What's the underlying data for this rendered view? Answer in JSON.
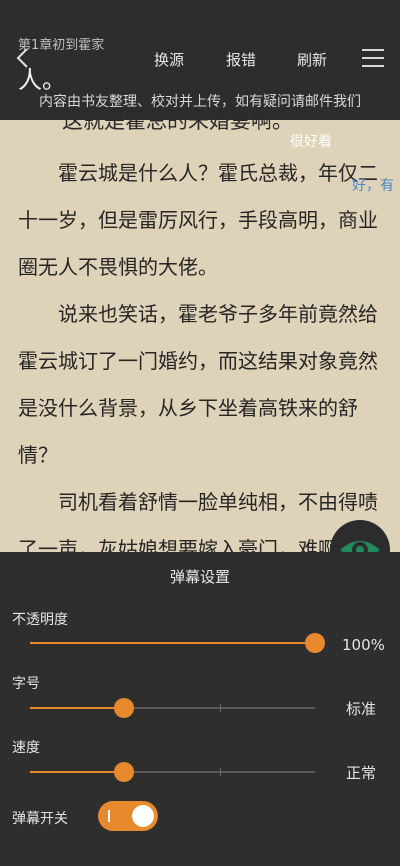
{
  "header": {
    "chapter_title": "第1章初到霍家",
    "actions": [
      "换源",
      "报错",
      "刷新"
    ],
    "notice": "内容由书友整理、校对并上传，如有疑问请邮件我们",
    "overlap_char": "人。"
  },
  "reader": {
    "first_line": "这就是霍总的未婚妻啊。",
    "paragraphs": [
      "霍云城是什么人？霍氏总裁，年仅二十一岁，但是雷厉风行，手段高明，商业圈无人不畏惧的大佬。",
      "说来也笑话，霍老爷子多年前竟然给霍云城订了一门婚约，而这结果对象竟然是没什么背景，从乡下坐着高铁来的舒情？",
      "司机看着舒情一脸单纯相，不由得啧了一声，灰姑娘想要嫁入豪门，难啊"
    ],
    "danmaku": [
      {
        "text": "很好看",
        "color": "#ffffff"
      },
      {
        "text": "好，有",
        "color": "#4a86c5"
      }
    ]
  },
  "danmaku_settings": {
    "title": "弹幕设置",
    "opacity": {
      "label": "不透明度",
      "value_text": "100%",
      "value": 1.0
    },
    "font_size": {
      "label": "字号",
      "value_text": "标准",
      "value": 0.33
    },
    "speed": {
      "label": "速度",
      "value_text": "正常",
      "value": 0.33
    },
    "toggle": {
      "label": "弹幕开关",
      "on": true
    }
  },
  "colors": {
    "accent": "#e8892e",
    "panel_bg": "#2e2e2e",
    "paper_bg": "#ded3b8"
  }
}
